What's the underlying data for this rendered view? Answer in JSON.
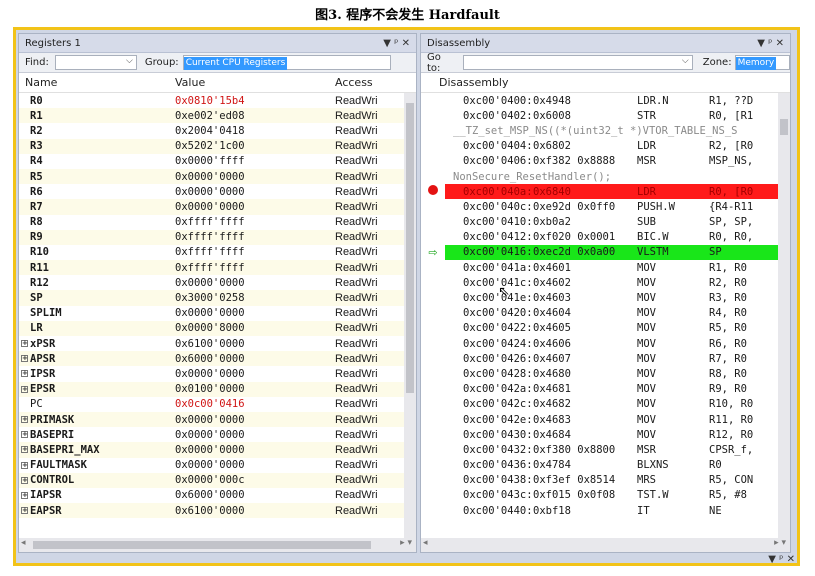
{
  "caption": "图3. 程序不会发生 Hardfault",
  "registers": {
    "title": "Registers 1",
    "controls": "▼ ᵖ ✕",
    "find_label": "Find:",
    "find_value": "",
    "group_label": "Group:",
    "group_value": "Current CPU Registers",
    "columns": [
      "Name",
      "Value",
      "Access"
    ],
    "rows": [
      {
        "name": "R0",
        "value": "0x0810'15b4",
        "access": "ReadWri",
        "changed": true
      },
      {
        "name": "R1",
        "value": "0xe002'ed08",
        "access": "ReadWri"
      },
      {
        "name": "R2",
        "value": "0x2004'0418",
        "access": "ReadWri"
      },
      {
        "name": "R3",
        "value": "0x5202'1c00",
        "access": "ReadWri"
      },
      {
        "name": "R4",
        "value": "0x0000'ffff",
        "access": "ReadWri"
      },
      {
        "name": "R5",
        "value": "0x0000'0000",
        "access": "ReadWri"
      },
      {
        "name": "R6",
        "value": "0x0000'0000",
        "access": "ReadWri"
      },
      {
        "name": "R7",
        "value": "0x0000'0000",
        "access": "ReadWri"
      },
      {
        "name": "R8",
        "value": "0xffff'ffff",
        "access": "ReadWri"
      },
      {
        "name": "R9",
        "value": "0xffff'ffff",
        "access": "ReadWri"
      },
      {
        "name": "R10",
        "value": "0xffff'ffff",
        "access": "ReadWri"
      },
      {
        "name": "R11",
        "value": "0xffff'ffff",
        "access": "ReadWri"
      },
      {
        "name": "R12",
        "value": "0x0000'0000",
        "access": "ReadWri"
      },
      {
        "name": "SP",
        "value": "0x3000'0258",
        "access": "ReadWri"
      },
      {
        "name": "SPLIM",
        "value": "0x0000'0000",
        "access": "ReadWri"
      },
      {
        "name": "LR",
        "value": "0x0000'8000",
        "access": "ReadWri"
      },
      {
        "name": "xPSR",
        "value": "0x6100'0000",
        "access": "ReadWri",
        "expand": true
      },
      {
        "name": "APSR",
        "value": "0x6000'0000",
        "access": "ReadWri",
        "expand": true
      },
      {
        "name": "IPSR",
        "value": "0x0000'0000",
        "access": "ReadWri",
        "expand": true
      },
      {
        "name": "EPSR",
        "value": "0x0100'0000",
        "access": "ReadWri",
        "expand": true
      },
      {
        "name": "PC",
        "value": "0x0c00'0416",
        "access": "ReadWri",
        "changed": true,
        "plain": true
      },
      {
        "name": "PRIMASK",
        "value": "0x0000'0000",
        "access": "ReadWri",
        "expand": true
      },
      {
        "name": "BASEPRI",
        "value": "0x0000'0000",
        "access": "ReadWri",
        "expand": true
      },
      {
        "name": "BASEPRI_MAX",
        "value": "0x0000'0000",
        "access": "ReadWri",
        "expand": true
      },
      {
        "name": "FAULTMASK",
        "value": "0x0000'0000",
        "access": "ReadWri",
        "expand": true
      },
      {
        "name": "CONTROL",
        "value": "0x0000'000c",
        "access": "ReadWri",
        "expand": true
      },
      {
        "name": "IAPSR",
        "value": "0x6000'0000",
        "access": "ReadWri",
        "expand": true
      },
      {
        "name": "EAPSR",
        "value": "0x6100'0000",
        "access": "ReadWri",
        "expand": true
      }
    ]
  },
  "disassembly": {
    "title": "Disassembly",
    "controls": "▼ ᵖ ✕",
    "goto_label": "Go to:",
    "goto_value": "",
    "zone_label": "Zone:",
    "zone_value": "Memory",
    "header": "Disassembly",
    "rows": [
      {
        "addr": "0xc00'0400:",
        "op": "0x4948",
        "mn": "LDR.N",
        "od": "R1, ??D"
      },
      {
        "addr": "0xc00'0402:",
        "op": "0x6008",
        "mn": "STR",
        "od": "R0, [R1"
      },
      {
        "src": "__TZ_set_MSP_NS((*(uint32_t *)VTOR_TABLE_NS_S"
      },
      {
        "addr": "0xc00'0404:",
        "op": "0x6802",
        "mn": "LDR",
        "od": "R2, [R0"
      },
      {
        "addr": "0xc00'0406:",
        "op": "0xf382 0x8888",
        "mn": "MSR",
        "od": "MSP_NS,"
      },
      {
        "src": "NonSecure_ResetHandler();"
      },
      {
        "addr": "0xc00'040a:",
        "op": "0x6840",
        "mn": "LDR",
        "od": "R0, [R0",
        "bp": true
      },
      {
        "addr": "0xc00'040c:",
        "op": "0xe92d 0x0ff0",
        "mn": "PUSH.W",
        "od": "{R4-R11"
      },
      {
        "addr": "0xc00'0410:",
        "op": "0xb0a2",
        "mn": "SUB",
        "od": "SP, SP,"
      },
      {
        "addr": "0xc00'0412:",
        "op": "0xf020 0x0001",
        "mn": "BIC.W",
        "od": "R0, R0,"
      },
      {
        "addr": "0xc00'0416:",
        "op": "0xec2d 0x0a00",
        "mn": "VLSTM",
        "od": "SP",
        "cur": true
      },
      {
        "addr": "0xc00'041a:",
        "op": "0x4601",
        "mn": "MOV",
        "od": "R1, R0"
      },
      {
        "addr": "0xc00'041c:",
        "op": "0x4602",
        "mn": "MOV",
        "od": "R2, R0"
      },
      {
        "addr": "0xc00'041e:",
        "op": "0x4603",
        "mn": "MOV",
        "od": "R3, R0"
      },
      {
        "addr": "0xc00'0420:",
        "op": "0x4604",
        "mn": "MOV",
        "od": "R4, R0"
      },
      {
        "addr": "0xc00'0422:",
        "op": "0x4605",
        "mn": "MOV",
        "od": "R5, R0"
      },
      {
        "addr": "0xc00'0424:",
        "op": "0x4606",
        "mn": "MOV",
        "od": "R6, R0"
      },
      {
        "addr": "0xc00'0426:",
        "op": "0x4607",
        "mn": "MOV",
        "od": "R7, R0"
      },
      {
        "addr": "0xc00'0428:",
        "op": "0x4680",
        "mn": "MOV",
        "od": "R8, R0"
      },
      {
        "addr": "0xc00'042a:",
        "op": "0x4681",
        "mn": "MOV",
        "od": "R9, R0"
      },
      {
        "addr": "0xc00'042c:",
        "op": "0x4682",
        "mn": "MOV",
        "od": "R10, R0"
      },
      {
        "addr": "0xc00'042e:",
        "op": "0x4683",
        "mn": "MOV",
        "od": "R11, R0"
      },
      {
        "addr": "0xc00'0430:",
        "op": "0x4684",
        "mn": "MOV",
        "od": "R12, R0"
      },
      {
        "addr": "0xc00'0432:",
        "op": "0xf380 0x8800",
        "mn": "MSR",
        "od": "CPSR_f,"
      },
      {
        "addr": "0xc00'0436:",
        "op": "0x4784",
        "mn": "BLXNS",
        "od": "R0"
      },
      {
        "addr": "0xc00'0438:",
        "op": "0xf3ef 0x8514",
        "mn": "MRS",
        "od": "R5, CON"
      },
      {
        "addr": "0xc00'043c:",
        "op": "0xf015 0x0f08",
        "mn": "TST.W",
        "od": "R5, #8"
      },
      {
        "addr": "0xc00'0440:",
        "op": "0xbf18",
        "mn": "IT",
        "od": "NE"
      }
    ]
  },
  "bottom_controls": "▼ ᵖ ✕",
  "colors": {
    "changed_value": "#d01515",
    "breakpoint": "#ff1a1a",
    "current_line": "#19e619",
    "frame": "#f2c318",
    "selection": "#3399ff"
  }
}
